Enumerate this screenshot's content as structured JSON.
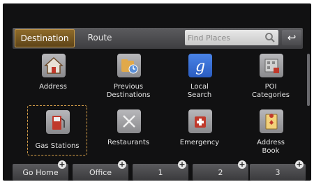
{
  "tabs": {
    "destination": "Destination",
    "route": "Route"
  },
  "search": {
    "placeholder": "Find Places"
  },
  "back_glyph": "↩",
  "tiles": [
    {
      "label": "Address",
      "icon": "house-icon"
    },
    {
      "label": "Previous\nDestinations",
      "icon": "previous-destinations-icon"
    },
    {
      "label": "Local\nSearch",
      "icon": "google-icon"
    },
    {
      "label": "POI\nCategories",
      "icon": "poi-icon"
    },
    {
      "label": "Gas Stations",
      "icon": "gas-pump-icon"
    },
    {
      "label": "Restaurants",
      "icon": "fork-knife-icon"
    },
    {
      "label": "Emergency",
      "icon": "emergency-icon"
    },
    {
      "label": "Address\nBook",
      "icon": "address-book-icon"
    }
  ],
  "bottom": [
    {
      "label": "Go Home"
    },
    {
      "label": "Office"
    },
    {
      "label": "1"
    },
    {
      "label": "2"
    },
    {
      "label": "3"
    }
  ],
  "plus_glyph": "+",
  "colors": {
    "accent": "#c99a45",
    "background": "#111112"
  }
}
